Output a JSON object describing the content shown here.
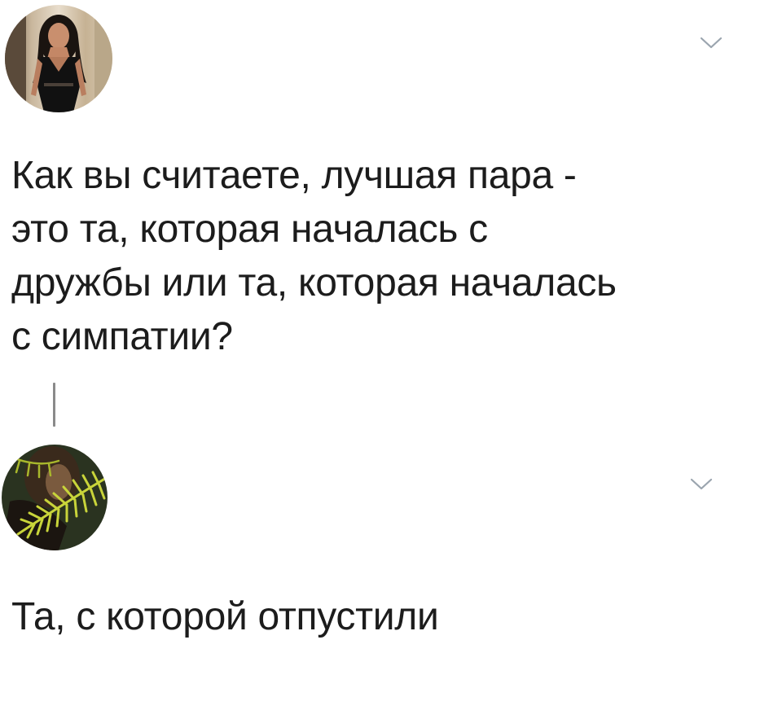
{
  "thread": {
    "tweets": [
      {
        "text": "Как вы считаете, лучшая пара -\nэто та, которая началась с\nдружбы или та, которая началась\nс симпатии?",
        "avatar_icon": "user-avatar-photo",
        "menu_icon": "chevron-down-icon"
      },
      {
        "text": "Та, с которой отпустили",
        "avatar_icon": "user-avatar-photo",
        "menu_icon": "chevron-down-icon"
      }
    ]
  },
  "colors": {
    "text": "#1c1c1c",
    "chevron": "#9aa4ae",
    "thread_line": "#8a8a8a",
    "background": "#ffffff"
  }
}
